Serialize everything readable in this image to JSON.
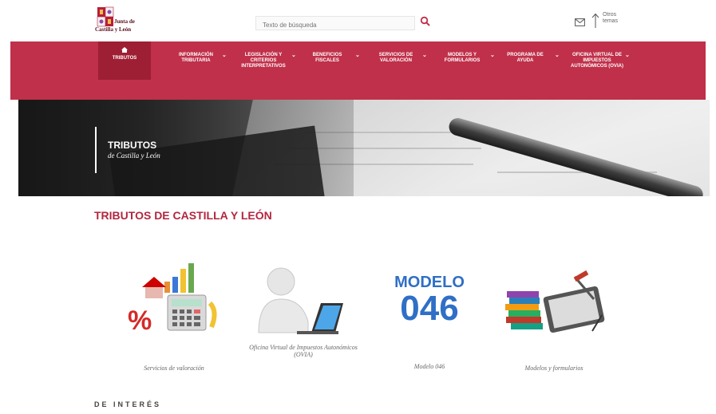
{
  "header": {
    "logo_line1": "Junta de",
    "logo_line2": "Castilla y León",
    "search_placeholder": "Texto de búsqueda",
    "other_topics": "Otros temas"
  },
  "nav": {
    "items": [
      {
        "label": "Tributos"
      },
      {
        "label": "Información tributaria"
      },
      {
        "label": "Legislación y criterios interpretativos"
      },
      {
        "label": "Beneficios fiscales"
      },
      {
        "label": "Servicios de valoración"
      },
      {
        "label": "Modelos y formularios"
      },
      {
        "label": "Programa de ayuda"
      },
      {
        "label": "Oficina virtual de impuestos autonómicos (OVIA)"
      }
    ]
  },
  "banner": {
    "title": "TRIBUTOS",
    "subtitle": "de Castilla y León"
  },
  "main": {
    "title": "TRIBUTOS DE CASTILLA Y LEÓN",
    "cards": [
      {
        "caption": "Servicios de valoración",
        "icon": "calculator-chart-icon"
      },
      {
        "caption": "Oficina Virtual de Impuestos Autonómicos (OVIA)",
        "icon": "user-laptop-icon"
      },
      {
        "caption": "Modelo 046",
        "icon": "modelo-046-icon",
        "m1": "MODELO",
        "m2": "046"
      },
      {
        "caption": "Modelos y formularios",
        "icon": "books-tablet-icon"
      }
    ],
    "section_heading": "DE INTERÉS"
  },
  "colors": {
    "brand": "#c0304a",
    "brand_dark": "#9e1f34",
    "title": "#b3263f",
    "model_blue": "#2f6fc6"
  }
}
